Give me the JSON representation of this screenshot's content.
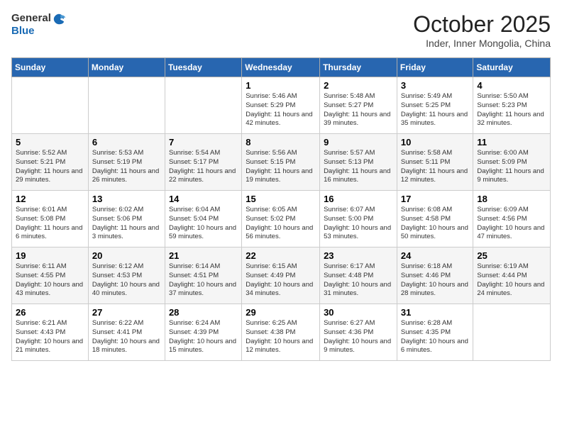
{
  "header": {
    "logo_general": "General",
    "logo_blue": "Blue",
    "month": "October 2025",
    "location": "Inder, Inner Mongolia, China"
  },
  "weekdays": [
    "Sunday",
    "Monday",
    "Tuesday",
    "Wednesday",
    "Thursday",
    "Friday",
    "Saturday"
  ],
  "weeks": [
    [
      {
        "day": "",
        "info": ""
      },
      {
        "day": "",
        "info": ""
      },
      {
        "day": "",
        "info": ""
      },
      {
        "day": "1",
        "info": "Sunrise: 5:46 AM\nSunset: 5:29 PM\nDaylight: 11 hours and 42 minutes."
      },
      {
        "day": "2",
        "info": "Sunrise: 5:48 AM\nSunset: 5:27 PM\nDaylight: 11 hours and 39 minutes."
      },
      {
        "day": "3",
        "info": "Sunrise: 5:49 AM\nSunset: 5:25 PM\nDaylight: 11 hours and 35 minutes."
      },
      {
        "day": "4",
        "info": "Sunrise: 5:50 AM\nSunset: 5:23 PM\nDaylight: 11 hours and 32 minutes."
      }
    ],
    [
      {
        "day": "5",
        "info": "Sunrise: 5:52 AM\nSunset: 5:21 PM\nDaylight: 11 hours and 29 minutes."
      },
      {
        "day": "6",
        "info": "Sunrise: 5:53 AM\nSunset: 5:19 PM\nDaylight: 11 hours and 26 minutes."
      },
      {
        "day": "7",
        "info": "Sunrise: 5:54 AM\nSunset: 5:17 PM\nDaylight: 11 hours and 22 minutes."
      },
      {
        "day": "8",
        "info": "Sunrise: 5:56 AM\nSunset: 5:15 PM\nDaylight: 11 hours and 19 minutes."
      },
      {
        "day": "9",
        "info": "Sunrise: 5:57 AM\nSunset: 5:13 PM\nDaylight: 11 hours and 16 minutes."
      },
      {
        "day": "10",
        "info": "Sunrise: 5:58 AM\nSunset: 5:11 PM\nDaylight: 11 hours and 12 minutes."
      },
      {
        "day": "11",
        "info": "Sunrise: 6:00 AM\nSunset: 5:09 PM\nDaylight: 11 hours and 9 minutes."
      }
    ],
    [
      {
        "day": "12",
        "info": "Sunrise: 6:01 AM\nSunset: 5:08 PM\nDaylight: 11 hours and 6 minutes."
      },
      {
        "day": "13",
        "info": "Sunrise: 6:02 AM\nSunset: 5:06 PM\nDaylight: 11 hours and 3 minutes."
      },
      {
        "day": "14",
        "info": "Sunrise: 6:04 AM\nSunset: 5:04 PM\nDaylight: 10 hours and 59 minutes."
      },
      {
        "day": "15",
        "info": "Sunrise: 6:05 AM\nSunset: 5:02 PM\nDaylight: 10 hours and 56 minutes."
      },
      {
        "day": "16",
        "info": "Sunrise: 6:07 AM\nSunset: 5:00 PM\nDaylight: 10 hours and 53 minutes."
      },
      {
        "day": "17",
        "info": "Sunrise: 6:08 AM\nSunset: 4:58 PM\nDaylight: 10 hours and 50 minutes."
      },
      {
        "day": "18",
        "info": "Sunrise: 6:09 AM\nSunset: 4:56 PM\nDaylight: 10 hours and 47 minutes."
      }
    ],
    [
      {
        "day": "19",
        "info": "Sunrise: 6:11 AM\nSunset: 4:55 PM\nDaylight: 10 hours and 43 minutes."
      },
      {
        "day": "20",
        "info": "Sunrise: 6:12 AM\nSunset: 4:53 PM\nDaylight: 10 hours and 40 minutes."
      },
      {
        "day": "21",
        "info": "Sunrise: 6:14 AM\nSunset: 4:51 PM\nDaylight: 10 hours and 37 minutes."
      },
      {
        "day": "22",
        "info": "Sunrise: 6:15 AM\nSunset: 4:49 PM\nDaylight: 10 hours and 34 minutes."
      },
      {
        "day": "23",
        "info": "Sunrise: 6:17 AM\nSunset: 4:48 PM\nDaylight: 10 hours and 31 minutes."
      },
      {
        "day": "24",
        "info": "Sunrise: 6:18 AM\nSunset: 4:46 PM\nDaylight: 10 hours and 28 minutes."
      },
      {
        "day": "25",
        "info": "Sunrise: 6:19 AM\nSunset: 4:44 PM\nDaylight: 10 hours and 24 minutes."
      }
    ],
    [
      {
        "day": "26",
        "info": "Sunrise: 6:21 AM\nSunset: 4:43 PM\nDaylight: 10 hours and 21 minutes."
      },
      {
        "day": "27",
        "info": "Sunrise: 6:22 AM\nSunset: 4:41 PM\nDaylight: 10 hours and 18 minutes."
      },
      {
        "day": "28",
        "info": "Sunrise: 6:24 AM\nSunset: 4:39 PM\nDaylight: 10 hours and 15 minutes."
      },
      {
        "day": "29",
        "info": "Sunrise: 6:25 AM\nSunset: 4:38 PM\nDaylight: 10 hours and 12 minutes."
      },
      {
        "day": "30",
        "info": "Sunrise: 6:27 AM\nSunset: 4:36 PM\nDaylight: 10 hours and 9 minutes."
      },
      {
        "day": "31",
        "info": "Sunrise: 6:28 AM\nSunset: 4:35 PM\nDaylight: 10 hours and 6 minutes."
      },
      {
        "day": "",
        "info": ""
      }
    ]
  ]
}
